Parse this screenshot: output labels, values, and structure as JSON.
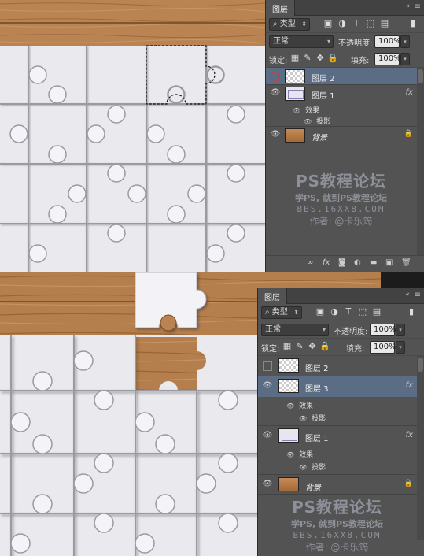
{
  "colors": {
    "panel_bg": "#535353",
    "selected_layer": "#5a6d85",
    "wood": "#b07a49",
    "puzzle_white": "#f2f2f6",
    "watermark": "#8d9099"
  },
  "top": {
    "panel": {
      "tab_title": "图层",
      "filter_kind": "类型",
      "blend_mode": "正常",
      "opacity_label": "不透明度:",
      "opacity_value": "100%",
      "lock_label": "锁定:",
      "fill_label": "填充:",
      "fill_value": "100%",
      "layers": [
        {
          "name": "图层 2",
          "selected": true,
          "visible": false,
          "thumb": "transparent"
        },
        {
          "name": "图层 1",
          "selected": false,
          "visible": true,
          "thumb": "puzzle",
          "fx": "fx",
          "effects_label": "效果",
          "effect": "投影"
        },
        {
          "name": "背景",
          "selected": false,
          "visible": true,
          "thumb": "wood",
          "locked": true
        }
      ]
    },
    "watermark": {
      "line1": "PS教程论坛",
      "line2": "学PS, 就到PS教程论坛",
      "line3": "BBS.16XX8.COM",
      "line4": "作者: @卡乐筠"
    }
  },
  "bottom": {
    "panel": {
      "tab_title": "图层",
      "filter_kind": "类型",
      "blend_mode": "正常",
      "opacity_label": "不透明度:",
      "opacity_value": "100%",
      "lock_label": "锁定:",
      "fill_label": "填充:",
      "fill_value": "100%",
      "layers": [
        {
          "name": "图层 2",
          "selected": false,
          "visible": false,
          "thumb": "transparent"
        },
        {
          "name": "图层 3",
          "selected": true,
          "visible": true,
          "thumb": "transparent",
          "fx": "fx",
          "effects_label": "效果",
          "effect": "投影"
        },
        {
          "name": "图层 1",
          "selected": false,
          "visible": true,
          "thumb": "puzzle",
          "fx": "fx",
          "effects_label": "效果",
          "effect": "投影"
        },
        {
          "name": "背景",
          "selected": false,
          "visible": true,
          "thumb": "wood",
          "locked": true
        }
      ]
    },
    "watermark": {
      "line1": "PS教程论坛",
      "line2": "学PS, 就到PS教程论坛",
      "line3": "BBS.16XX8.COM",
      "line4": "作者: @卡乐筠"
    }
  },
  "icons": {
    "eye": "eye-icon",
    "fx": "fx-icon",
    "lock": "lock-icon",
    "link": "link-icon",
    "mask": "mask-icon",
    "new_layer": "new-layer-icon",
    "trash": "trash-icon",
    "folder": "folder-icon",
    "adjustment": "adjustment-icon"
  }
}
